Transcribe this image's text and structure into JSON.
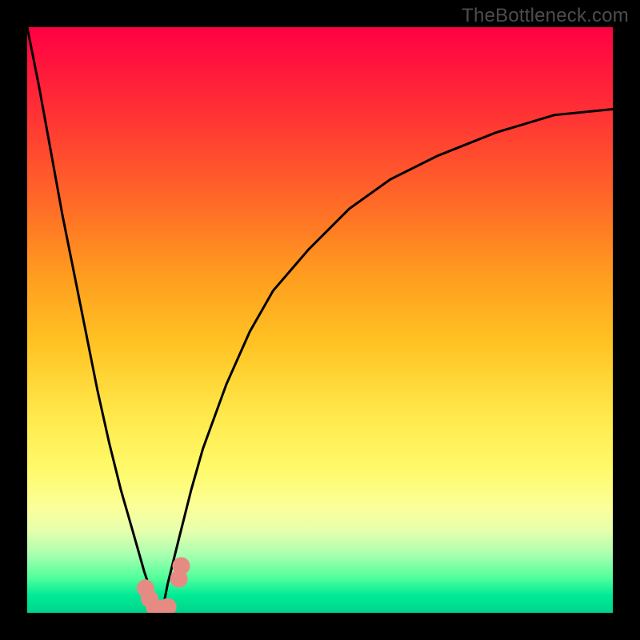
{
  "watermark": "TheBottleneck.com",
  "gradient": {
    "top": "#ff0043",
    "mid_top": "#ffa726",
    "mid": "#fff176",
    "mid_bottom": "#b2ff59",
    "bottom": "#00d58c"
  },
  "chart_data": {
    "type": "line",
    "title": "",
    "xlabel": "",
    "ylabel": "",
    "xlim": [
      0,
      100
    ],
    "ylim": [
      0,
      100
    ],
    "series": [
      {
        "name": "left-curve",
        "x": [
          0,
          2,
          4,
          6,
          8,
          10,
          12,
          14,
          16,
          18,
          20,
          21,
          22,
          23
        ],
        "y": [
          100,
          90,
          79,
          68,
          58,
          48,
          38,
          29,
          21,
          14,
          7,
          4,
          2,
          0
        ]
      },
      {
        "name": "right-curve",
        "x": [
          23,
          24,
          26,
          28,
          30,
          34,
          38,
          42,
          48,
          55,
          62,
          70,
          80,
          90,
          100
        ],
        "y": [
          0,
          5,
          13,
          21,
          28,
          39,
          48,
          55,
          62,
          69,
          74,
          78,
          82,
          85,
          86
        ]
      }
    ],
    "markers": {
      "name": "bottom-markers",
      "color": "#e68b84",
      "points": [
        {
          "x": 20.2,
          "y": 4.2
        },
        {
          "x": 20.9,
          "y": 2.4
        },
        {
          "x": 21.8,
          "y": 0.9
        },
        {
          "x": 22.8,
          "y": 0.7
        },
        {
          "x": 24.0,
          "y": 1.0
        },
        {
          "x": 25.9,
          "y": 5.8
        },
        {
          "x": 26.3,
          "y": 8.0
        }
      ]
    }
  }
}
